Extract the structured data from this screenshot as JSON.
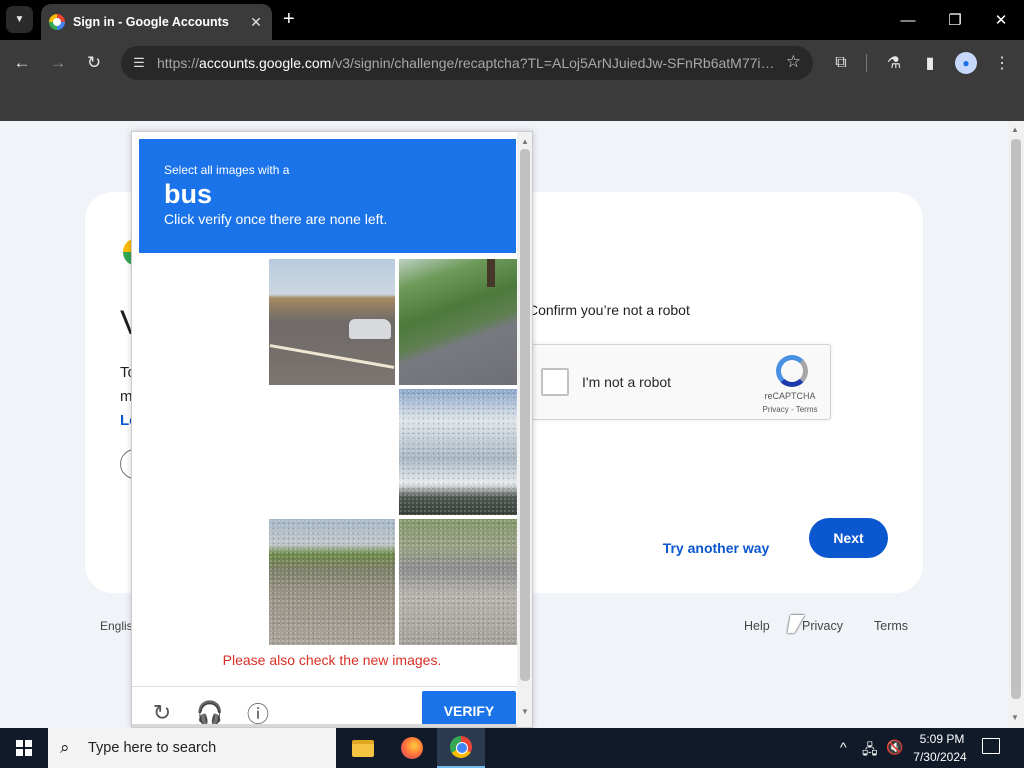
{
  "browser": {
    "tab_title": "Sign in - Google Accounts",
    "tab_close": "✕",
    "new_tab": "+",
    "url_prefix": "https://",
    "url_host": "accounts.google.com",
    "url_rest": "/v3/signin/challenge/recaptcha?TL=ALoj5ArNJuiedJw-SFnRb6atM77iz...",
    "icons": [
      "tab-search-icon",
      "google-favicon",
      "back-icon",
      "forward-icon",
      "reload-icon",
      "site-info-icon",
      "star-icon",
      "extensions-icon",
      "labs-icon",
      "side-panel-icon",
      "profile-icon",
      "menu-icon",
      "minimize-icon",
      "restore-icon",
      "close-icon"
    ]
  },
  "page": {
    "heading_partial": "V",
    "body_partial_1": "To",
    "body_partial_2": "m",
    "link_partial": "Le",
    "confirm_text": "Confirm you’re not a robot",
    "recaptcha": {
      "label": "I'm not a robot",
      "brand": "reCAPTCHA",
      "links": "Privacy - Terms"
    },
    "try_another": "Try another way",
    "next": "Next",
    "footer": {
      "language_partial": "Englis",
      "help": "Help",
      "privacy": "Privacy",
      "terms": "Terms"
    }
  },
  "challenge": {
    "line1": "Select all images with a",
    "object": "bus",
    "line2": "Click verify once there are none left.",
    "error": "Please also check the new images.",
    "verify": "VERIFY",
    "header_color": "#1a73e8",
    "error_color": "#d93025",
    "icons": [
      "reload-icon",
      "audio-icon",
      "info-icon"
    ]
  },
  "taskbar": {
    "search_placeholder": "Type here to search",
    "time": "5:09 PM",
    "date": "7/30/2024",
    "apps": [
      "file-explorer",
      "firefox",
      "chrome"
    ]
  }
}
